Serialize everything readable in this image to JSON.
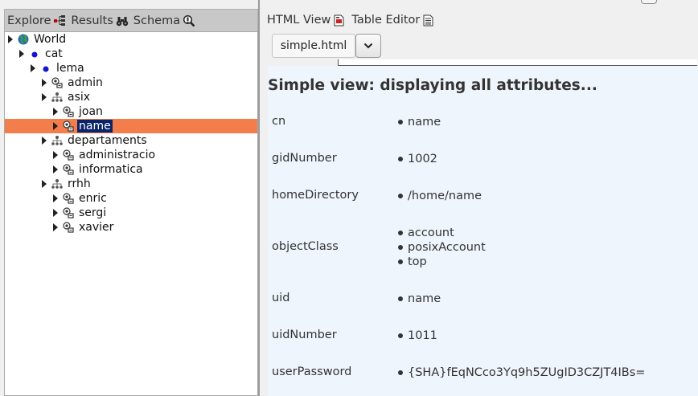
{
  "left_tabs": [
    {
      "label": "Explore",
      "icon": "tree-icon"
    },
    {
      "label": "Results",
      "icon": "binoculars-icon"
    },
    {
      "label": "Schema",
      "icon": "magnifier-icon"
    }
  ],
  "tree": [
    {
      "label": "World",
      "icon": "globe-icon"
    },
    {
      "label": "cat",
      "icon": "dot-icon"
    },
    {
      "label": "lema",
      "icon": "dot-icon"
    },
    {
      "label": "admin",
      "icon": "person-icon"
    },
    {
      "label": "asix",
      "icon": "group-icon"
    },
    {
      "label": "joan",
      "icon": "person-icon"
    },
    {
      "label": "name",
      "icon": "person-icon",
      "selected": true
    },
    {
      "label": "departaments",
      "icon": "group-icon"
    },
    {
      "label": "administracio",
      "icon": "person-icon"
    },
    {
      "label": "informatica",
      "icon": "person-icon"
    },
    {
      "label": "rrhh",
      "icon": "group-icon"
    },
    {
      "label": "enric",
      "icon": "person-icon"
    },
    {
      "label": "sergi",
      "icon": "person-icon"
    },
    {
      "label": "xavier",
      "icon": "person-icon"
    }
  ],
  "right_tabs": [
    {
      "label": "HTML View",
      "icon": "html-page-icon"
    },
    {
      "label": "Table Editor",
      "icon": "table-page-icon"
    }
  ],
  "file_tab": "simple.html",
  "heading": "Simple view: displaying all attributes...",
  "attributes": [
    {
      "name": "cn",
      "values": [
        "name"
      ]
    },
    {
      "name": "gidNumber",
      "values": [
        "1002"
      ]
    },
    {
      "name": "homeDirectory",
      "values": [
        "/home/name"
      ]
    },
    {
      "name": "objectClass",
      "values": [
        "account",
        "posixAccount",
        "top"
      ]
    },
    {
      "name": "uid",
      "values": [
        "name"
      ]
    },
    {
      "name": "uidNumber",
      "values": [
        "1011"
      ]
    },
    {
      "name": "userPassword",
      "values": [
        "{SHA}fEqNCco3Yq9h5ZUgID3CZJT4IBs="
      ]
    }
  ],
  "colors": {
    "selection": "#f47e4b",
    "label_selection": "#0a246a",
    "content_bg": "#eef5fc"
  }
}
